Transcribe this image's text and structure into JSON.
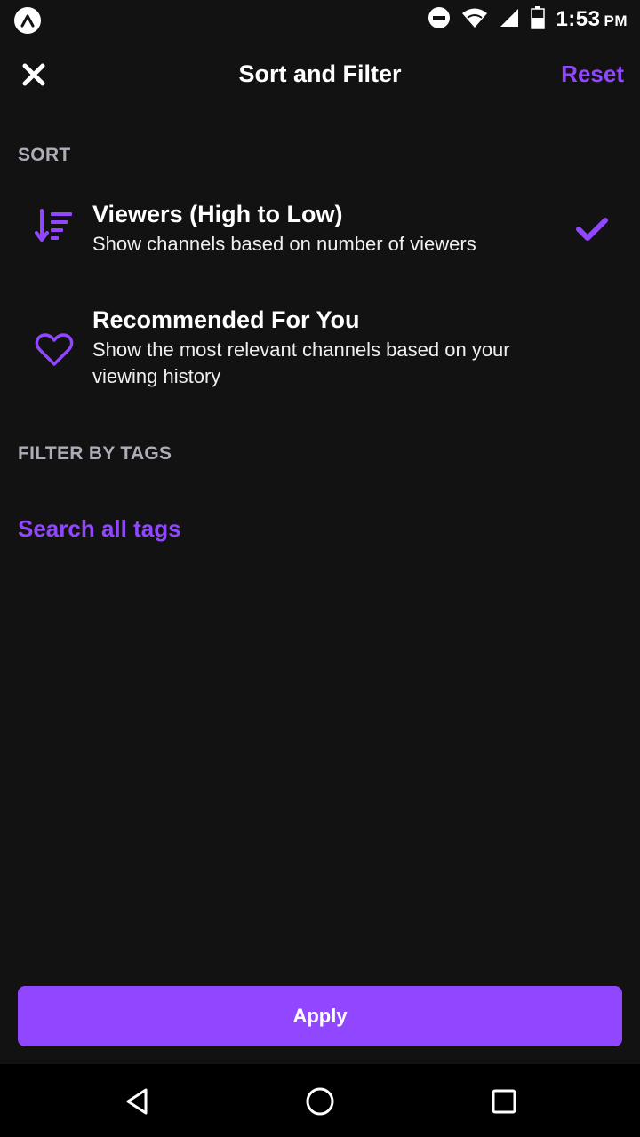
{
  "status_bar": {
    "time": "1:53",
    "ampm": "PM",
    "icons": [
      "app-notification-icon",
      "do-not-disturb-icon",
      "wifi-icon",
      "signal-icon",
      "battery-icon"
    ]
  },
  "header": {
    "title": "Sort and Filter",
    "reset_label": "Reset",
    "close_icon": "close-icon"
  },
  "sort": {
    "section_label": "SORT",
    "options": [
      {
        "title": "Viewers (High to Low)",
        "description": "Show channels based on number of viewers",
        "icon": "sort-descending-icon",
        "selected": true
      },
      {
        "title": "Recommended For You",
        "description": "Show the most relevant channels based on your viewing history",
        "icon": "heart-icon",
        "selected": false
      }
    ]
  },
  "filter": {
    "section_label": "FILTER BY TAGS",
    "search_link": "Search all tags"
  },
  "apply_label": "Apply",
  "colors": {
    "accent": "#9147ff",
    "background": "#121212",
    "section_label": "#adadb8"
  },
  "nav": {
    "icons": [
      "back-icon",
      "home-icon",
      "recents-icon"
    ]
  }
}
